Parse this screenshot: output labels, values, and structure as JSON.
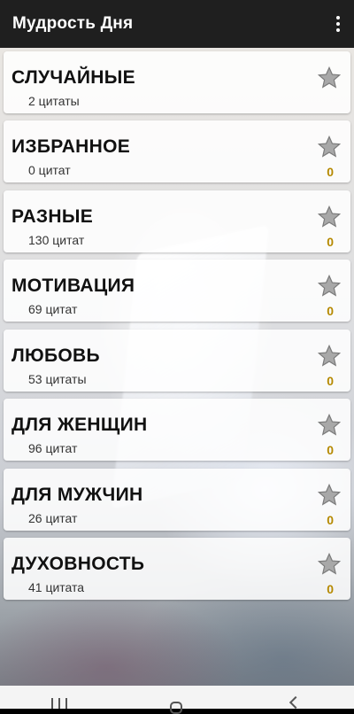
{
  "app": {
    "title": "Мудрость Дня"
  },
  "colors": {
    "appbar": "#1f1f1f",
    "favorite_count": "#b58900",
    "star_gray": "#9e9e9e"
  },
  "categories": [
    {
      "name": "СЛУЧАЙНЫЕ",
      "count": "2 цитаты",
      "favorites": ""
    },
    {
      "name": "ИЗБРАННОЕ",
      "count": "0 цитат",
      "favorites": "0"
    },
    {
      "name": "РАЗНЫЕ",
      "count": "130 цитат",
      "favorites": "0"
    },
    {
      "name": "МОТИВАЦИЯ",
      "count": "69 цитат",
      "favorites": "0"
    },
    {
      "name": "ЛЮБОВЬ",
      "count": "53 цитаты",
      "favorites": "0"
    },
    {
      "name": "ДЛЯ ЖЕНЩИН",
      "count": "96 цитат",
      "favorites": "0"
    },
    {
      "name": "ДЛЯ МУЖЧИН",
      "count": "26 цитат",
      "favorites": "0"
    },
    {
      "name": "ДУХОВНОСТЬ",
      "count": "41 цитата",
      "favorites": "0"
    }
  ],
  "icons": {
    "menu": "more-vert-icon",
    "star": "star-icon",
    "recents": "recents-icon",
    "home": "home-icon",
    "back": "back-icon"
  }
}
